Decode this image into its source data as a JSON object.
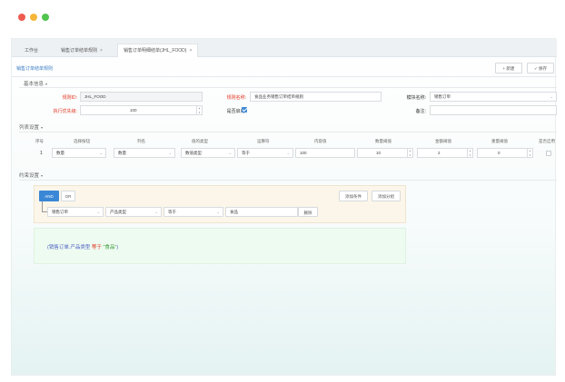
{
  "window": {
    "dot_colors": [
      "#ee5c50",
      "#f5b63a",
      "#52c450"
    ]
  },
  "tabs": [
    {
      "label": "工作台",
      "closable": false,
      "active": false
    },
    {
      "label": "销售订单结单规则",
      "closable": true,
      "active": false
    },
    {
      "label": "销售订单明细结单(JHL_FOOD)",
      "closable": true,
      "active": true
    }
  ],
  "toolbar": {
    "page_title": "销售订单结单规则",
    "new_label": "+ 新建",
    "save_label": "✓ 保存"
  },
  "basic": {
    "section_title": "基本信息",
    "rule_code_label": "规则ID:",
    "rule_code_value": "JHL_FOOD",
    "rule_name_label": "规则名称:",
    "rule_name_value": "食品业务销售订单结单规则",
    "module_label": "模块名称:",
    "module_value": "销售订单",
    "priority_label": "执行优先级:",
    "priority_value": "100",
    "enabled_label": "是否启用:",
    "enabled": true,
    "remark_label": "备注:",
    "remark_value": ""
  },
  "cols": {
    "section_title": "列表设置",
    "headers": [
      "序号",
      "选择按钮",
      "列名",
      "值的类型",
      "运算符",
      "内容值",
      "数量阈值",
      "金额阈值",
      "重量阈值",
      "是否启用"
    ],
    "rows": [
      {
        "seq": "1",
        "select": "数量",
        "column": "数量",
        "type": "数值类型",
        "operator": "等于",
        "content": "100",
        "qty": "10",
        "amount": "2",
        "weight": "0",
        "enabled": false
      }
    ]
  },
  "conds": {
    "section_title": "约束设置",
    "and_label": "AND",
    "or_label": "OR",
    "add_cond_label": "添加条件",
    "add_group_label": "添加分组",
    "row": {
      "field": "销售订单",
      "subfield": "产品类型",
      "operator": "等于",
      "value": "食品",
      "delete_label": "删除"
    }
  },
  "expression": {
    "prefix": "(销售订单.产品类型",
    "operator": "等于",
    "value": "\"食品\"",
    "suffix": ")"
  }
}
